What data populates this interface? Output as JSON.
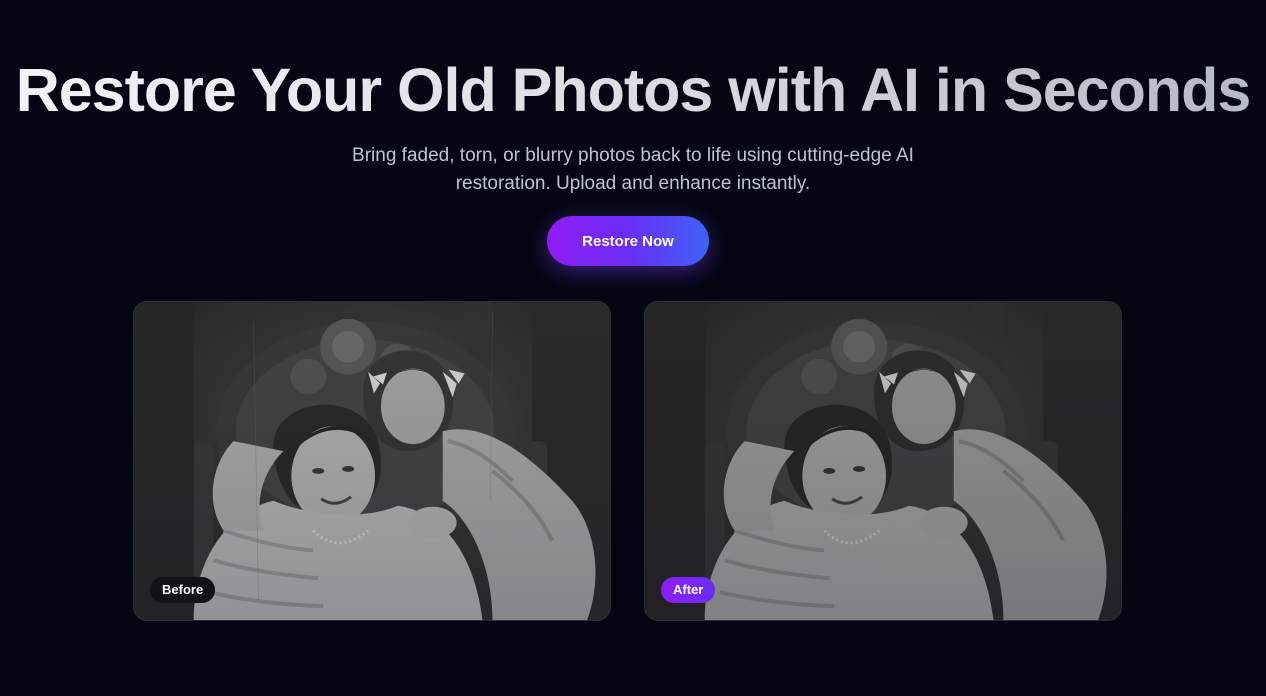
{
  "hero": {
    "title": "Restore Your Old Photos with AI in Seconds",
    "subtitle_line1": "Bring faded, torn, or blurry photos back to life using cutting-edge AI",
    "subtitle_line2": "restoration. Upload and enhance instantly.",
    "cta_label": "Restore Now"
  },
  "comparison": {
    "before_label": "Before",
    "after_label": "After",
    "photo_description_icon": "vintage-portrait-photo"
  },
  "colors": {
    "background": "#040713",
    "accent_start": "#8f1cf5",
    "accent_end": "#3d63f6",
    "subtitle": "#bfc3cf"
  }
}
